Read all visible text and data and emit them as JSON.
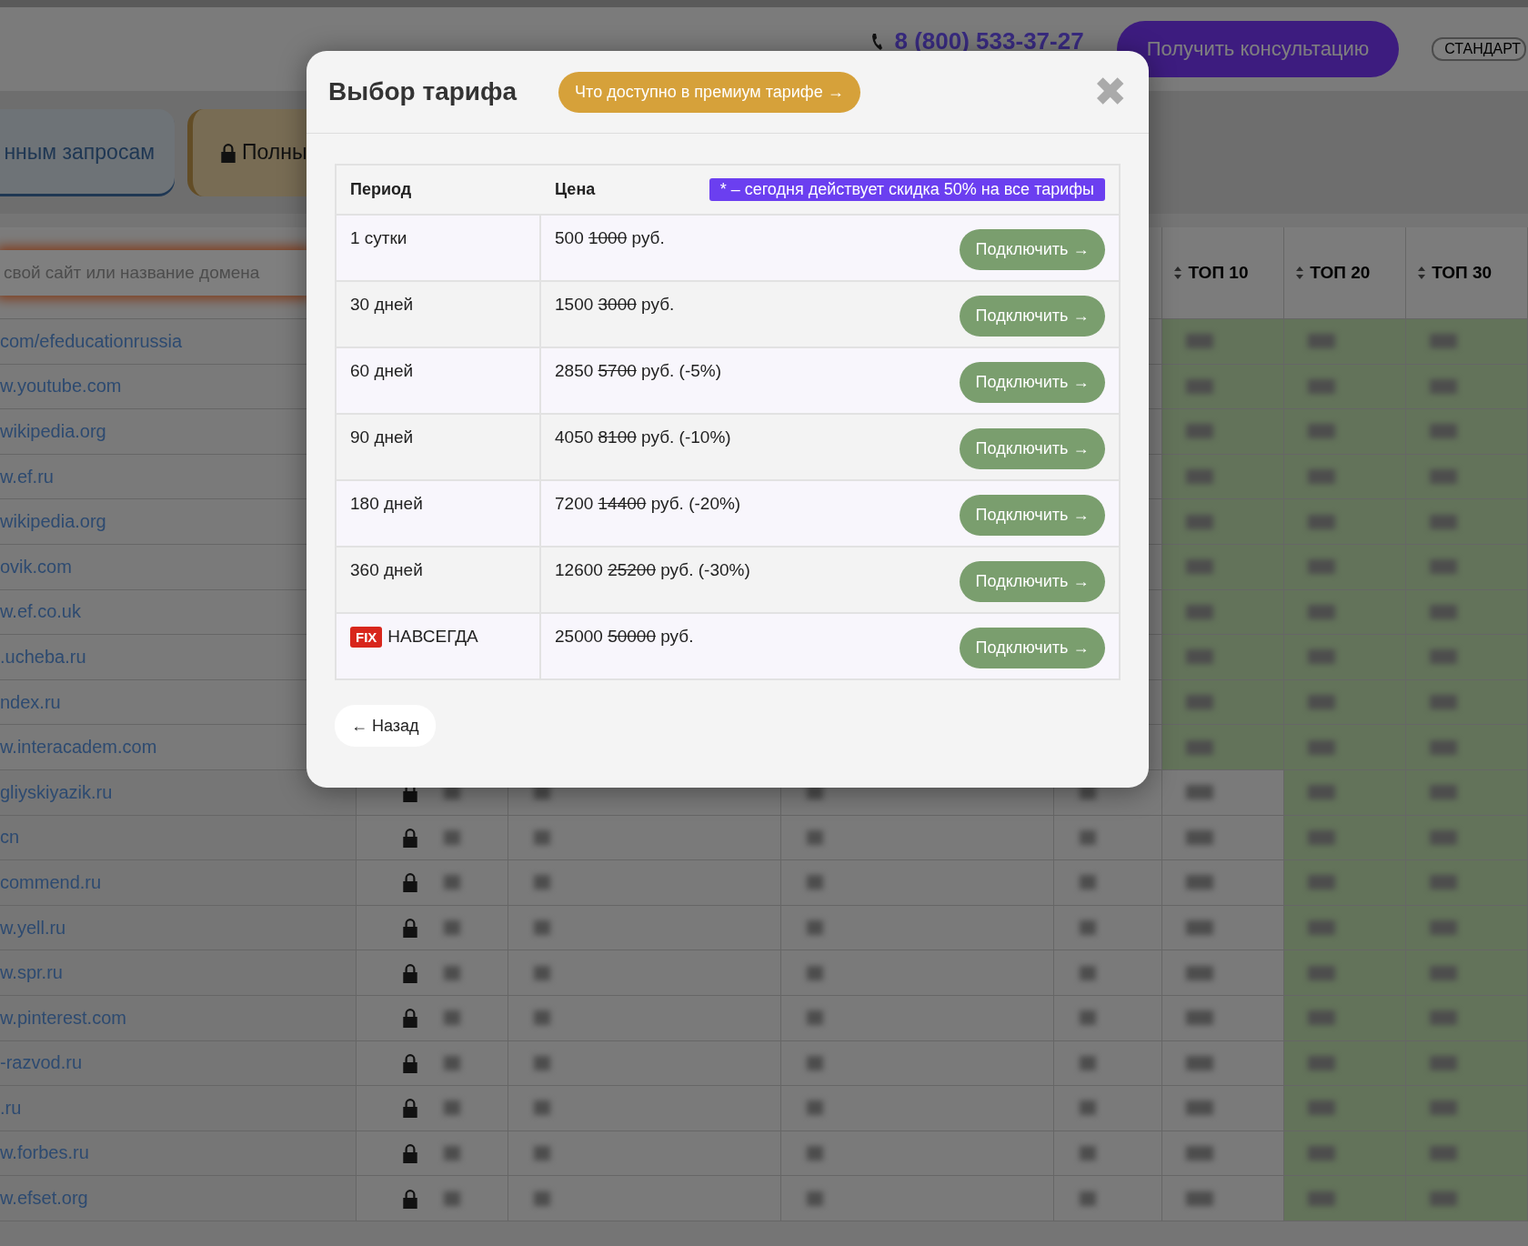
{
  "header": {
    "phone": "8 (800) 533-37-27",
    "consult_button": "Получить консультацию",
    "plan_badge": "СТАНДАРТ"
  },
  "tabs": [
    {
      "label": "нным запросам",
      "kind": "open",
      "selected": true
    },
    {
      "label": "Полны",
      "kind": "locked",
      "selected": false
    }
  ],
  "search": {
    "placeholder": "свой сайт или название домена"
  },
  "table": {
    "columns": [
      "ТОП 10",
      "ТОП 20",
      "ТОП 30"
    ],
    "rows": [
      {
        "domain": "com/efeducationrussia",
        "locked": false,
        "top10_highlight": true
      },
      {
        "domain": "w.youtube.com",
        "locked": false,
        "top10_highlight": true
      },
      {
        "domain": "wikipedia.org",
        "locked": false,
        "top10_highlight": true
      },
      {
        "domain": "w.ef.ru",
        "locked": false,
        "top10_highlight": true
      },
      {
        "domain": "wikipedia.org",
        "locked": false,
        "top10_highlight": true
      },
      {
        "domain": "ovik.com",
        "locked": false,
        "top10_highlight": true
      },
      {
        "domain": "w.ef.co.uk",
        "locked": false,
        "top10_highlight": true
      },
      {
        "domain": ".ucheba.ru",
        "locked": false,
        "top10_highlight": true
      },
      {
        "domain": "ndex.ru",
        "locked": false,
        "top10_highlight": true
      },
      {
        "domain": "w.interacadem.com",
        "locked": false,
        "top10_highlight": true
      },
      {
        "domain": "gliyskiyazik.ru",
        "locked": true,
        "top10_highlight": false
      },
      {
        "domain": "cn",
        "locked": true,
        "top10_highlight": false
      },
      {
        "domain": "commend.ru",
        "locked": true,
        "top10_highlight": false
      },
      {
        "domain": "w.yell.ru",
        "locked": true,
        "top10_highlight": false
      },
      {
        "domain": "w.spr.ru",
        "locked": true,
        "top10_highlight": false
      },
      {
        "domain": "w.pinterest.com",
        "locked": true,
        "top10_highlight": false
      },
      {
        "domain": "-razvod.ru",
        "locked": true,
        "top10_highlight": false
      },
      {
        "domain": ".ru",
        "locked": true,
        "top10_highlight": false
      },
      {
        "domain": "w.forbes.ru",
        "locked": true,
        "top10_highlight": false
      },
      {
        "domain": "w.efset.org",
        "locked": true,
        "top10_highlight": false
      }
    ]
  },
  "modal": {
    "title": "Выбор тарифа",
    "premium_link": "Что доступно в премиум тарифе →",
    "close": "✖",
    "columns": [
      "Период",
      "Цена"
    ],
    "note": "* – сегодня действует скидка 50% на все тарифы",
    "plans": [
      {
        "period": "1 сутки",
        "price": "500",
        "old_price": "1000",
        "rest": "руб.",
        "button": "Подключить →"
      },
      {
        "period": "30 дней",
        "price": "1500",
        "old_price": "3000",
        "rest": "руб.",
        "button": "Подключить →"
      },
      {
        "period": "60 дней",
        "price": "2850",
        "old_price": "5700",
        "rest": "руб. (-5%)",
        "button": "Подключить →"
      },
      {
        "period": "90 дней",
        "price": "4050",
        "old_price": "8100",
        "rest": "руб. (-10%)",
        "button": "Подключить →"
      },
      {
        "period": "180 дней",
        "price": "7200",
        "old_price": "14400",
        "rest": "руб. (-20%)",
        "button": "Подключить →"
      },
      {
        "period": "360 дней",
        "price": "12600",
        "old_price": "25200",
        "rest": "руб. (-30%)",
        "button": "Подключить →"
      },
      {
        "period": "НАВСЕГДА",
        "badge": "FIX",
        "price": "25000",
        "old_price": "50000",
        "rest": "руб.",
        "button": "Подключить →"
      }
    ],
    "back_button": "← Назад"
  }
}
